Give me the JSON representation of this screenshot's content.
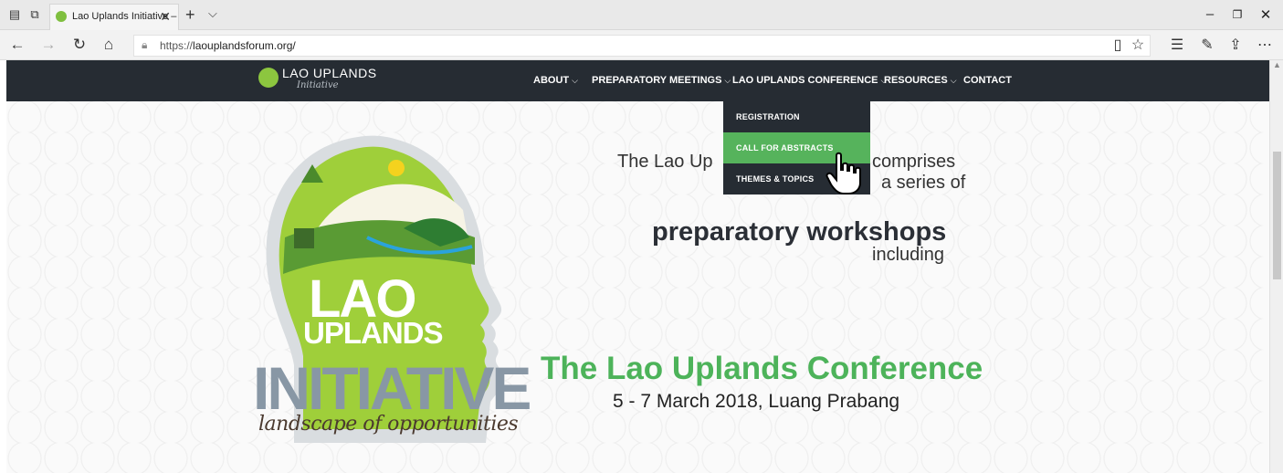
{
  "browser": {
    "tab_title": "Lao Uplands Initiative –",
    "tab_close": "✕",
    "new_tab": "+",
    "tab_list": "⌵",
    "url_prefix": "https://",
    "url_host": "laouplandsforum.org/",
    "window_controls": [
      "–",
      "❐",
      "✕"
    ]
  },
  "site": {
    "logo_title": "LAO UPLANDS",
    "logo_subtitle": "Initiative",
    "menu": [
      {
        "label": "ABOUT",
        "has_dropdown": true
      },
      {
        "label": "PREPARATORY MEETINGS",
        "has_dropdown": true
      },
      {
        "label": "LAO UPLANDS CONFERENCE",
        "has_dropdown": true
      },
      {
        "label": "RESOURCES",
        "has_dropdown": true
      },
      {
        "label": "CONTACT",
        "has_dropdown": false
      }
    ],
    "chevron": "⌵",
    "dropdown": [
      {
        "label": "REGISTRATION",
        "active": false
      },
      {
        "label": "CALL FOR ABSTRACTS",
        "active": true
      },
      {
        "label": "THEMES & TOPICS",
        "active": false
      }
    ]
  },
  "hero": {
    "logo_lao": "LAO",
    "logo_uplands": "UPLANDS",
    "logo_initiative": "INITIATIVE",
    "logo_tagline": "landscape of opportunities",
    "line1": "The Lao Up",
    "line1_end": "comprises",
    "line2": "a series of",
    "line3": "preparatory workshops",
    "line4": "including",
    "conference_title": "The Lao Uplands Conference",
    "conference_date": "5 - 7 March 2018, Luang Prabang"
  },
  "colors": {
    "nav_bg": "#262c33",
    "accent_green": "#56b35c",
    "title_green": "#4db35a",
    "initiative_grey": "#8897a5"
  }
}
